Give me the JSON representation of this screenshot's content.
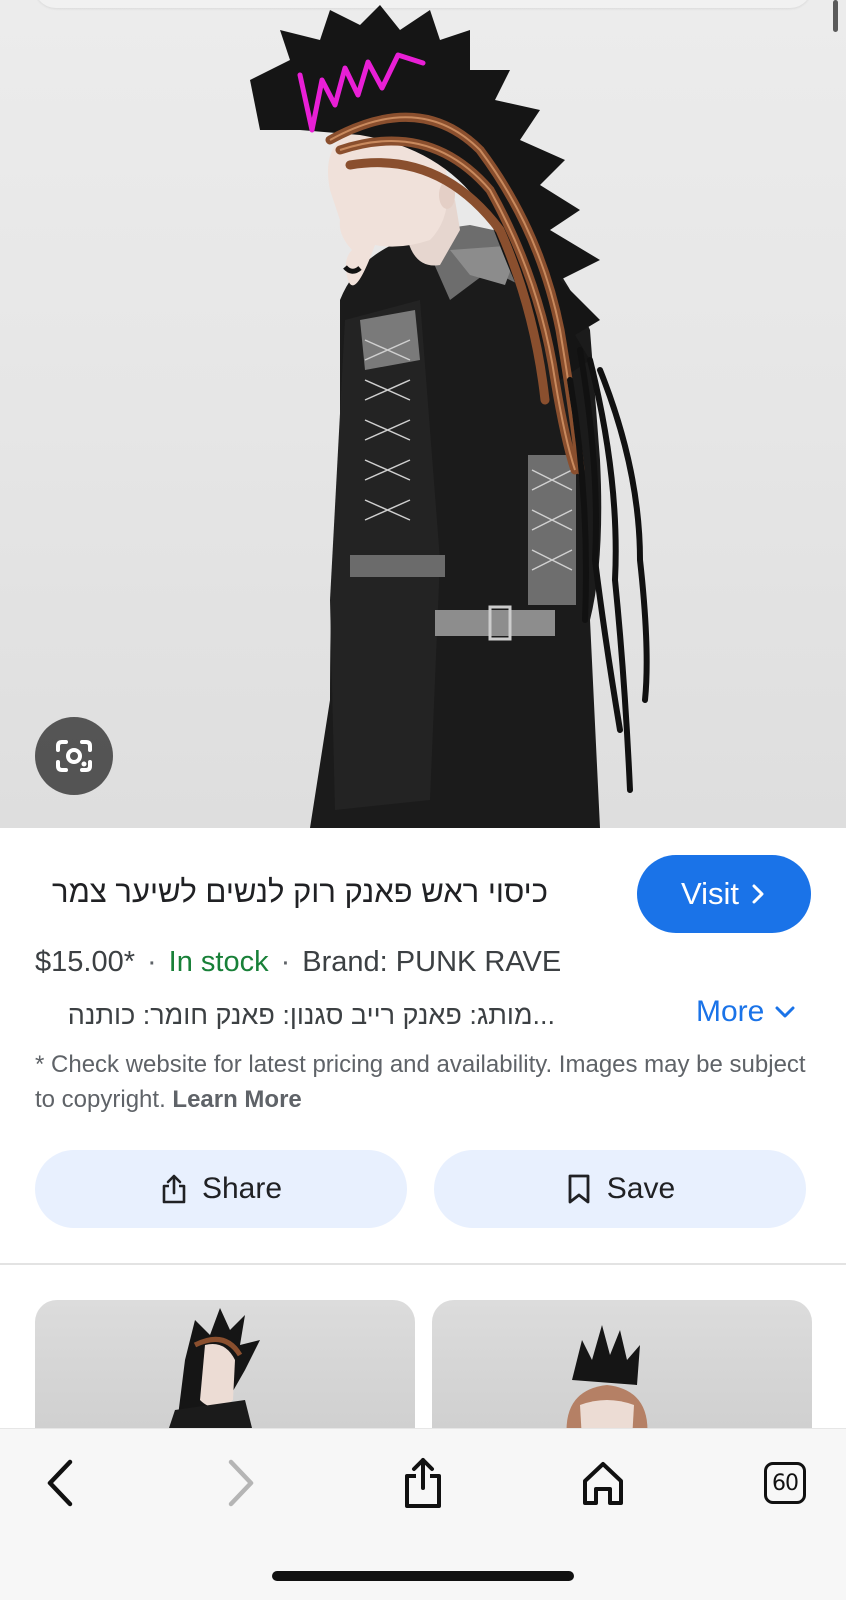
{
  "product": {
    "title": "כיסוי ראש פאנק רוק לנשים לשיער צמר",
    "visit_label": "Visit",
    "price": "$15.00*",
    "separator": "·",
    "stock": "In stock",
    "brand": "Brand: PUNK RAVE",
    "attributes": "...מותג: פאנק רייב סגנון: פאנק חומר: כותנה",
    "more_label": "More",
    "disclaimer": "* Check website for latest pricing and availability. Images may be subject to copyright.",
    "learn_more": "Learn More"
  },
  "actions": {
    "share_label": "Share",
    "save_label": "Save"
  },
  "browser": {
    "tab_count": "60"
  },
  "colors": {
    "accent": "#1a73e8",
    "stock_green": "#188038",
    "pill_bg": "#e8f0fe",
    "annotation_magenta": "#e91fd6"
  },
  "icons": {
    "lens": "google-lens-icon",
    "visit": "chevron-right-icon",
    "more": "chevron-down-icon",
    "share": "share-icon",
    "save": "bookmark-icon",
    "back": "back-arrow-icon",
    "forward": "forward-arrow-icon",
    "home": "home-icon",
    "tabs": "tabs-icon"
  }
}
